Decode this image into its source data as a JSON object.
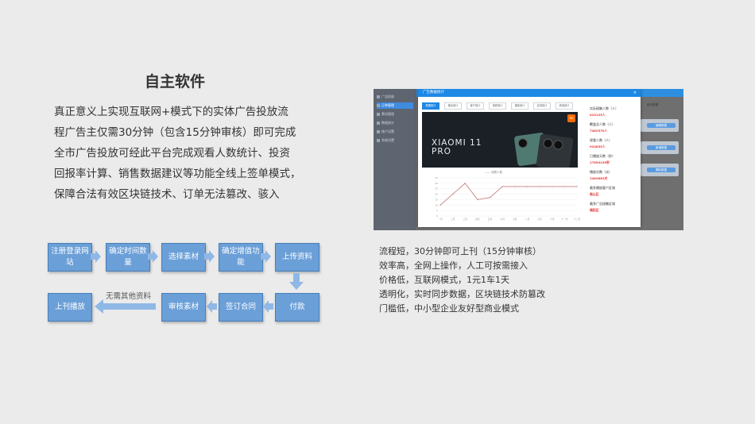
{
  "page": {
    "title": "自主软件",
    "description": [
      "真正意义上实现互联网+模式下的实体广告投放流",
      "程广告主仅需30分钟（包含15分钟审核）即可完成",
      "全市广告投放可经此平台完成观看人数统计、投资",
      "回报率计算、销售数据建议等功能全线上签单模式，",
      "保障合法有效区块链技术、订单无法篡改、骇入"
    ]
  },
  "flow": {
    "row1": [
      "注册登录网站",
      "确定时间数量",
      "选择素材",
      "确定增值功能",
      "上传资料"
    ],
    "row2": [
      "付款",
      "签订合同",
      "审核素材",
      "上刊播放"
    ],
    "skip_label": "无需其他资料"
  },
  "screenshot": {
    "sidebar_items": [
      "广告投放",
      "订单管理",
      "素材管理",
      "数据统计",
      "账户设置",
      "系统设置"
    ],
    "modal_title": "广告数据统计",
    "tabs": [
      "数据统计",
      "播出统计",
      "客户统计",
      "观看统计",
      "播放统计",
      "区域统计",
      "其他统计"
    ],
    "banner_text_line1": "XIAOMI 11",
    "banner_text_line2": "PRO",
    "logo_text": "mi",
    "legend": "—— 观看人数",
    "stats": [
      {
        "label": "实际接触人数（人）",
        "value": "423125人"
      },
      {
        "label": "覆盖总人数（人）",
        "value": "7482570人"
      },
      {
        "label": "观看人数（人）",
        "value": "924855人"
      },
      {
        "label": "已播放天数（秒）",
        "value": "17854159秒"
      },
      {
        "label": "播放次数（次）",
        "value": "1483682次"
      },
      {
        "label": "最多播放客户区域",
        "value": "南山区"
      },
      {
        "label": "最多广告接触区域",
        "value": "福田区"
      }
    ],
    "right_buttons": [
      "编辑数据",
      "新增数据",
      "删除数据"
    ],
    "right_header": "统计数据",
    "chart_data": {
      "type": "line",
      "categories": [
        "一月",
        "二月",
        "三月",
        "四月",
        "五月",
        "六月",
        "七月",
        "八月",
        "九月",
        "十月",
        "十一月",
        "十二月"
      ],
      "series": [
        {
          "name": "观看人数",
          "values": [
            10,
            20,
            30,
            15,
            17,
            27,
            27,
            27,
            27,
            27,
            27,
            27
          ]
        }
      ],
      "ylim": [
        0,
        35
      ]
    }
  },
  "features": [
    "流程短，30分钟即可上刊（15分钟审核）",
    "效率高，全网上操作，人工可按需接入",
    "价格低，互联网模式，1元1车1天",
    "透明化，实时同步数据，区块链技术防篡改",
    "门槛低，中小型企业友好型商业模式"
  ]
}
